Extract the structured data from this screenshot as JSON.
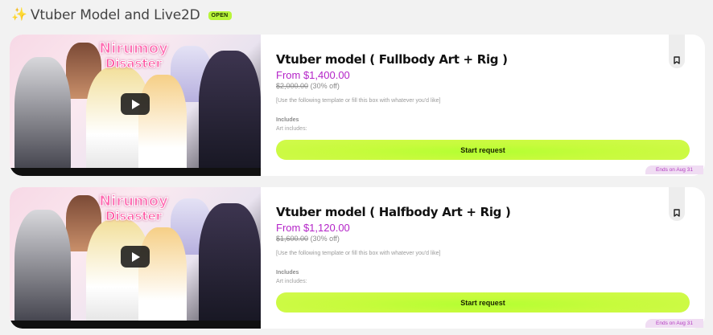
{
  "section": {
    "title": "Vtuber Model and Live2D",
    "status_badge": "OPEN",
    "icon": "sparkle-icon"
  },
  "products": [
    {
      "thumbnail_logo_line1": "Nirumoy",
      "thumbnail_logo_line2": "Disaster",
      "name": "Vtuber model ( Fullbody Art + Rig )",
      "price": "From $1,400.00",
      "original_price": "$2,000.00",
      "discount": "(30% off)",
      "description": "[Use the following template or fill this box with whatever you'd like]",
      "includes_label": "Includes",
      "art_includes": "Art includes:",
      "button_label": "Start request",
      "ends": "Ends on Aug 31"
    },
    {
      "thumbnail_logo_line1": "Nirumoy",
      "thumbnail_logo_line2": "Disaster",
      "name": "Vtuber model ( Halfbody Art + Rig )",
      "price": "From $1,120.00",
      "original_price": "$1,600.00",
      "discount": "(30% off)",
      "description": "[Use the following template or fill this box with whatever you'd like]",
      "includes_label": "Includes",
      "art_includes": "Art includes:",
      "button_label": "Start request",
      "ends": "Ends on Aug 31"
    }
  ],
  "colors": {
    "accent_green": "#c6fb3a",
    "price_purple": "#b424c8",
    "ends_bg": "#f0ddf3"
  }
}
